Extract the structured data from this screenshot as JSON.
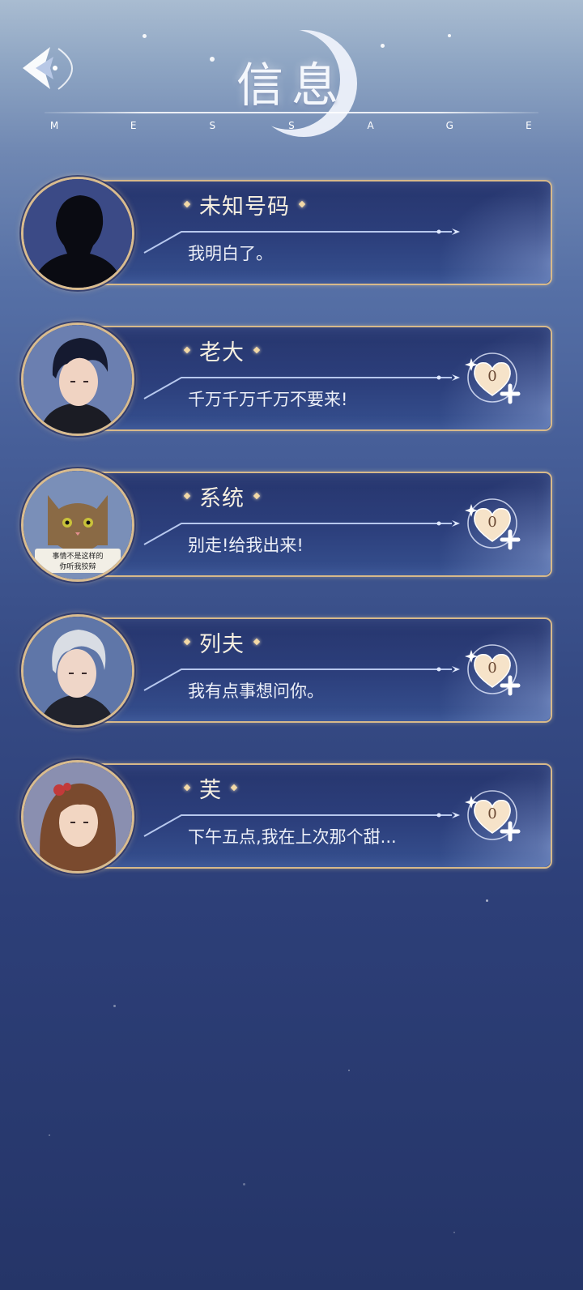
{
  "header": {
    "title": "信息",
    "subtitle_letters": [
      "M",
      "E",
      "S",
      "S",
      "A",
      "G",
      "E"
    ]
  },
  "icons": {
    "back": "back-arrow-icon",
    "favor": "heart-plus-icon"
  },
  "colors": {
    "card_border": "#d7b98a",
    "card_bg": "#2c3f7c",
    "name_text": "#f6efe0"
  },
  "contacts": [
    {
      "name": "未知号码",
      "message": "我明白了。",
      "avatar": "silhouette-avatar",
      "favor": null
    },
    {
      "name": "老大",
      "message": "千万千万千万不要来!",
      "avatar": "dark-hair-man-avatar",
      "favor": "0"
    },
    {
      "name": "系统",
      "message": "别走!给我出来!",
      "avatar": "cat-avatar",
      "sign_text": "事情不是这样的 你听我狡辩",
      "favor": "0"
    },
    {
      "name": "列夫",
      "message": "我有点事想问你。",
      "avatar": "silver-hair-man-avatar",
      "favor": "0"
    },
    {
      "name": "芙",
      "message": "下午五点,我在上次那个甜...",
      "avatar": "brown-hair-woman-avatar",
      "favor": "0"
    }
  ]
}
